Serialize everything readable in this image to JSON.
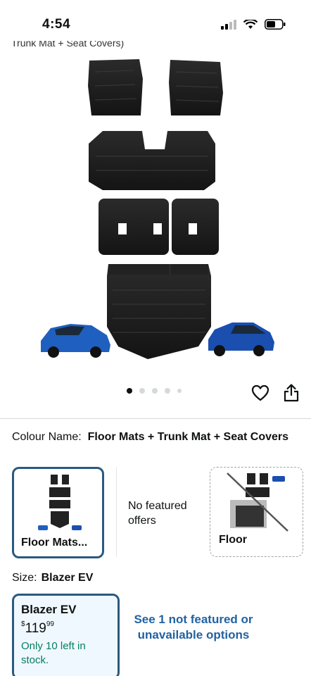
{
  "status": {
    "time": "4:54"
  },
  "title_cut": "Trunk Mat + Seat Covers)",
  "gallery": {
    "image_alt": "Floor Mats + Trunk Mat + Seat Covers product image",
    "dots": 5,
    "active_dot": 0
  },
  "actions": {
    "like_icon": "heart-icon",
    "share_icon": "share-icon"
  },
  "colour": {
    "label": "Colour Name:",
    "value": "Floor Mats + Trunk Mat + Seat Covers"
  },
  "swatches": [
    {
      "label": "Floor Mats..."
    },
    {
      "label": "No featured offers"
    },
    {
      "label": "Floor"
    }
  ],
  "size": {
    "label": "Size:",
    "value": "Blazer EV"
  },
  "size_option": {
    "name": "Blazer EV",
    "price_symbol": "$",
    "price_whole": "119",
    "price_fraction": "99",
    "stock": "Only 10 left in stock."
  },
  "see_more": "See 1 not featured or unavailable options",
  "colors": {
    "accent": "#2a5a80",
    "link": "#2162a1",
    "stock": "#067d62"
  }
}
